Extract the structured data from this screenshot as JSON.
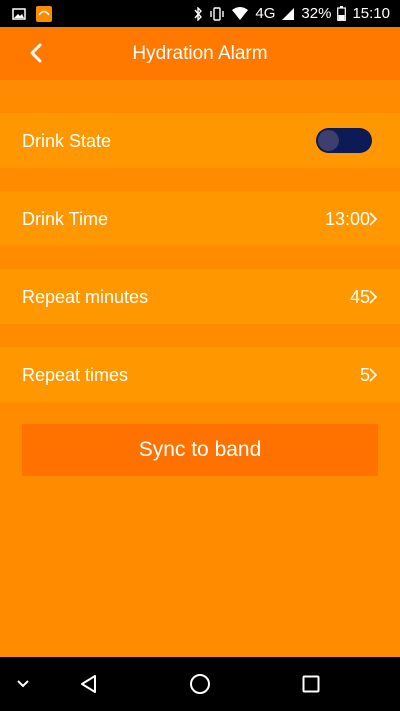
{
  "status_bar": {
    "left_icons": [
      "image-icon",
      "app-notification-icon"
    ],
    "right_icons": [
      "bluetooth-icon",
      "vibrate-icon",
      "wifi-icon",
      "signal-icon",
      "battery-icon"
    ],
    "network": "4G",
    "battery": "32%",
    "time": "15:10"
  },
  "header": {
    "title": "Hydration Alarm",
    "back_icon": "chevron-left-icon"
  },
  "settings": {
    "drink_state": {
      "label": "Drink State",
      "enabled": false
    },
    "drink_time": {
      "label": "Drink Time",
      "value": "13:00"
    },
    "repeat_minutes": {
      "label": "Repeat minutes",
      "value": "45"
    },
    "repeat_times": {
      "label": "Repeat times",
      "value": "5"
    }
  },
  "sync_button": {
    "label": "Sync to band"
  },
  "nav_bar": {
    "icons": [
      "collapse-icon",
      "back-icon",
      "home-icon",
      "recents-icon"
    ]
  },
  "colors": {
    "background": "#ff8c00",
    "header": "#ff7800",
    "row": "#ff9800",
    "toggle_track": "#0c1a55",
    "button": "#ff7200"
  }
}
